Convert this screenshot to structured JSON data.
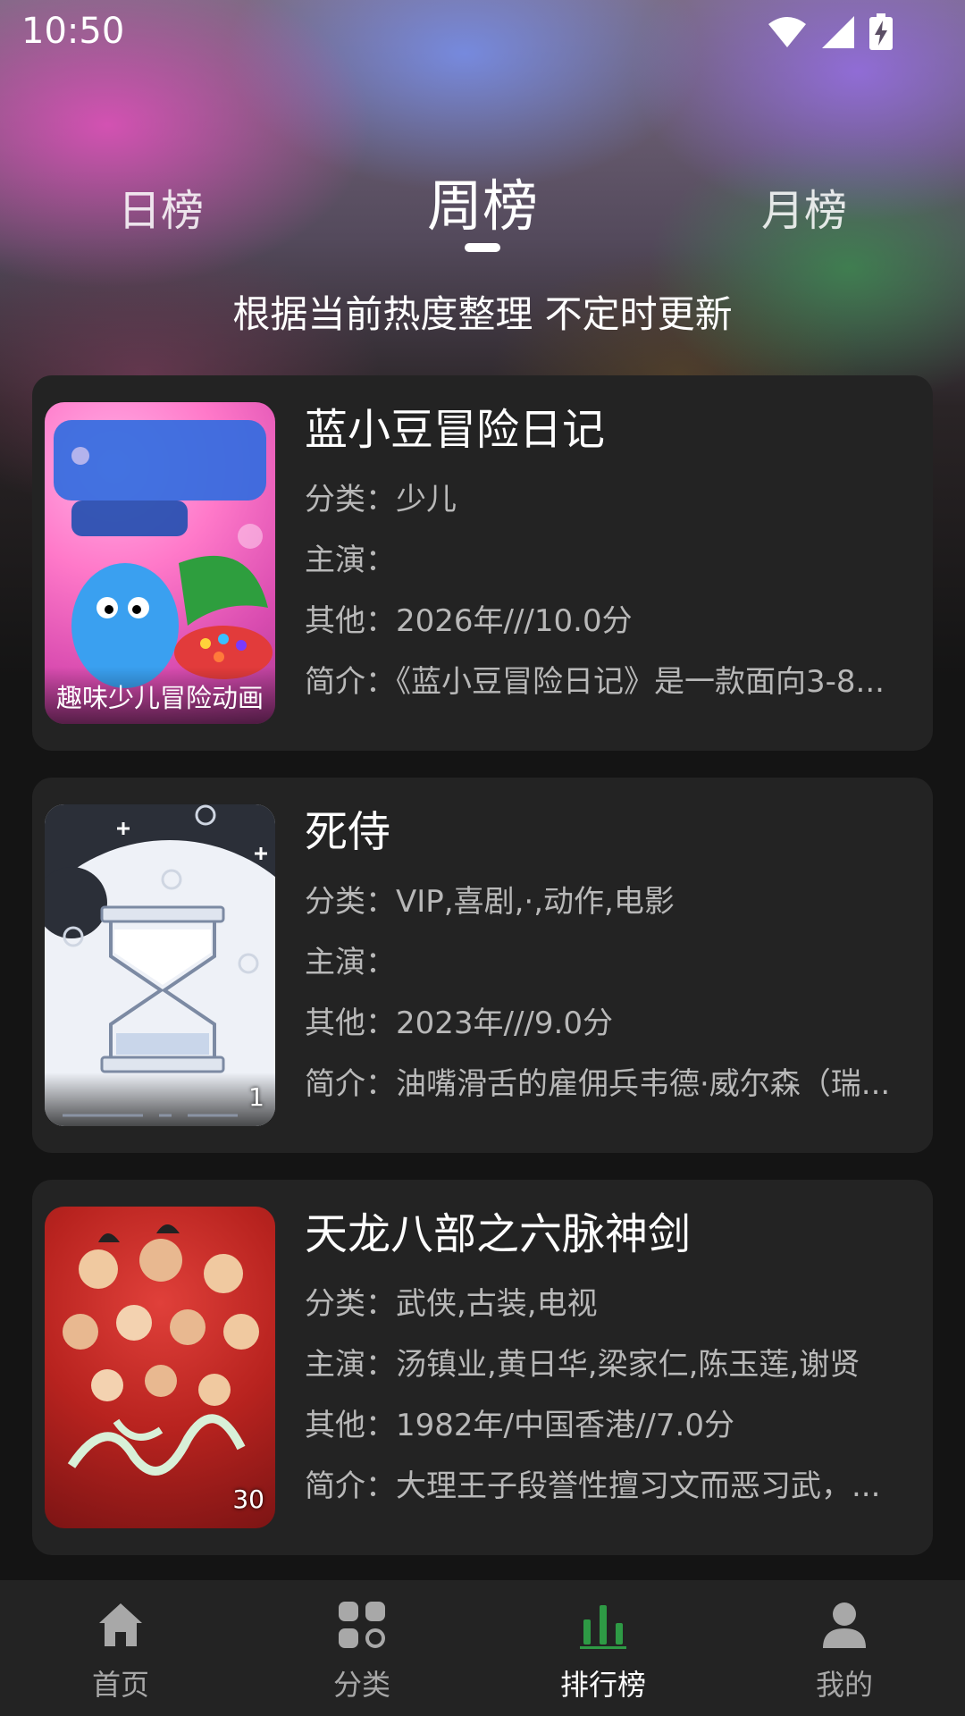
{
  "status_bar": {
    "time": "10:50",
    "icons": [
      "wifi-icon",
      "signal-icon",
      "battery-charging-icon"
    ]
  },
  "tabs": {
    "daily": "日榜",
    "weekly": "周榜",
    "monthly": "月榜",
    "active": "weekly"
  },
  "subtitle": "根据当前热度整理 不定时更新",
  "labels": {
    "category": "分类：",
    "cast": "主演：",
    "other": "其他：",
    "intro": "简介："
  },
  "cards": [
    {
      "title": "蓝小豆冒险日记",
      "category": "少儿",
      "cast": "",
      "other": "2026年///10.0分",
      "intro": "《蓝小豆冒险日记》是一款面向3-8...",
      "poster_caption": "趣味少儿冒险动画",
      "poster_badge": ""
    },
    {
      "title": "死侍",
      "category": "VIP,喜剧,·,动作,电影",
      "cast": "",
      "other": "2023年///9.0分",
      "intro": "油嘴滑舌的雇佣兵韦德·威尔森（瑞...",
      "poster_caption": "",
      "poster_badge": "1"
    },
    {
      "title": "天龙八部之六脉神剑",
      "category": "武侠,古装,电视",
      "cast": "汤镇业,黄日华,梁家仁,陈玉莲,谢贤",
      "other": "1982年/中国香港//7.0分",
      "intro": "大理王子段誉性擅习文而恶习武，...",
      "poster_caption": "",
      "poster_badge": "30"
    }
  ],
  "bottom_nav": [
    {
      "label": "首页",
      "icon": "home-icon"
    },
    {
      "label": "分类",
      "icon": "category-icon"
    },
    {
      "label": "排行榜",
      "icon": "ranking-icon"
    },
    {
      "label": "我的",
      "icon": "profile-icon"
    }
  ],
  "colors": {
    "accent": "#2e9a45",
    "card_bg": "#232323",
    "nav_inactive": "#a8a8a8"
  }
}
